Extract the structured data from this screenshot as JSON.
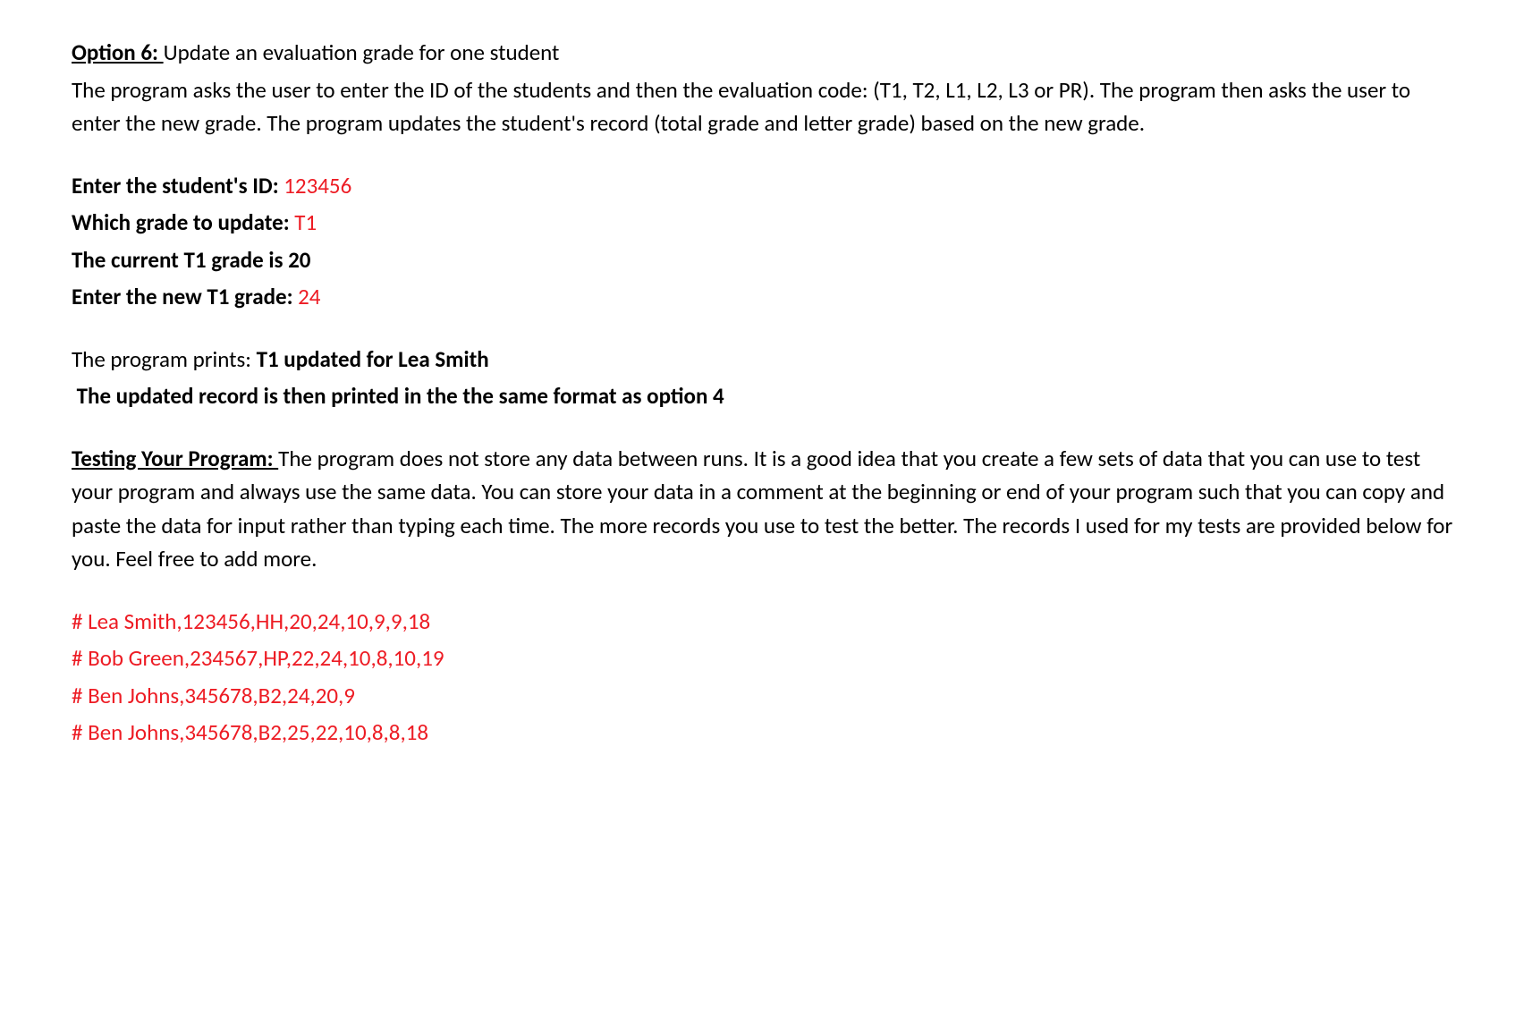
{
  "option6": {
    "label": "Option 6: ",
    "title": "Update an evaluation grade for one student",
    "description": "The program asks the user to enter the ID of the students and then the evaluation code: (T1, T2, L1, L2, L3 or PR). The program then asks the user to enter the new grade. The program updates the student's record (total grade and letter grade) based on the new grade."
  },
  "prompts": {
    "id_label": "Enter the student's ID: ",
    "id_value": "123456",
    "which_label": "Which grade to update: ",
    "which_value": "T1",
    "current_label": "The current T1 grade is 20",
    "new_label": "Enter the new T1 grade: ",
    "new_value": "24"
  },
  "result": {
    "prefix": "The program prints: ",
    "message": "T1 updated for Lea Smith",
    "note": "The updated record is then printed in the the same format as option 4"
  },
  "testing": {
    "label": "Testing Your Program: ",
    "description": "The program does not store any data between runs. It is a good idea that you create a few sets of data that you can use to test your program and always use the same data. You can store your data in a comment at the beginning or end of your program such that you can copy and paste the data for input rather than typing each time. The more records you use to test the better. The records I used for my tests are provided below for you. Feel free to add more."
  },
  "test_data": {
    "line1": "# Lea Smith,123456,HH,20,24,10,9,9,18",
    "line2": "# Bob Green,234567,HP,22,24,10,8,10,19",
    "line3": "# Ben Johns,345678,B2,24,20,9",
    "line4": "# Ben Johns,345678,B2,25,22,10,8,8,18"
  }
}
